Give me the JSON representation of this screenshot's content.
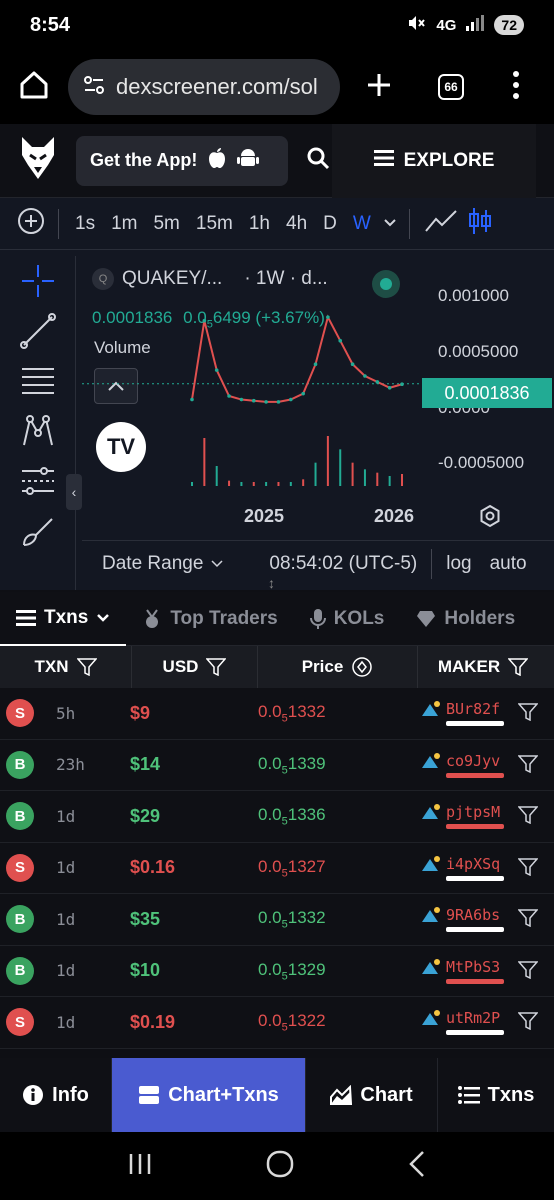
{
  "status": {
    "time": "8:54",
    "network": "4G",
    "battery": "72"
  },
  "browser": {
    "url": "dexscreener.com/sol",
    "tab_count": "66"
  },
  "header": {
    "get_app_label": "Get the App!",
    "explore_label": "EXPLORE"
  },
  "timeframes": {
    "items": [
      "1s",
      "1m",
      "5m",
      "15m",
      "1h",
      "4h",
      "D",
      "W"
    ],
    "active": "W"
  },
  "chart": {
    "title": "QUAKEY/...",
    "interval": "· 1W · d...",
    "legend_price": "0.0001836",
    "legend_change_prefix": "0.0",
    "legend_change_sub": "5",
    "legend_change_rest": "6499 (+3.67%)",
    "volume_label": "Volume",
    "current_price": "0.0001836",
    "y_ticks": [
      "0.001000",
      "0.0005000",
      "0.0000",
      "-0.0005000"
    ],
    "x_ticks": [
      "2025",
      "2026"
    ],
    "date_range_label": "Date Range",
    "clock": "08:54:02 (UTC-5)",
    "log_label": "log",
    "auto_label": "auto"
  },
  "chart_data": {
    "type": "line",
    "title": "QUAKEY/...",
    "x": [
      "2024-07",
      "2024-08",
      "2024-09",
      "2024-10",
      "2024-11",
      "2024-12",
      "2025-01",
      "2025-02",
      "2025-03",
      "2025-04",
      "2025-05",
      "2025-06",
      "2025-07",
      "2025-08",
      "2025-09",
      "2025-10",
      "2025-11",
      "2025-12"
    ],
    "series": [
      {
        "values": [
          5e-05,
          0.00072,
          0.0003,
          8e-05,
          5e-05,
          4e-05,
          3e-05,
          3e-05,
          5e-05,
          0.0001,
          0.00035,
          0.00075,
          0.00055,
          0.00035,
          0.00025,
          0.0002,
          0.00015,
          0.00018
        ]
      }
    ],
    "ylim": [
      -0.0006,
      0.0011
    ]
  },
  "txn_tabs": [
    "Txns",
    "Top Traders",
    "KOLs",
    "Holders"
  ],
  "table": {
    "headers": {
      "txn": "TXN",
      "usd": "USD",
      "price": "Price",
      "maker": "MAKER"
    },
    "rows": [
      {
        "type": "S",
        "age": "5h",
        "usd": "$9",
        "price_prefix": "0.0",
        "price_sub": "5",
        "price_rest": "1332",
        "maker": "BUr82f",
        "maker_color": "#e0504f",
        "bar_color": "#ffffff"
      },
      {
        "type": "B",
        "age": "23h",
        "usd": "$14",
        "price_prefix": "0.0",
        "price_sub": "5",
        "price_rest": "1339",
        "maker": "co9Jyv",
        "maker_color": "#e0504f",
        "bar_color": "#e0504f"
      },
      {
        "type": "B",
        "age": "1d",
        "usd": "$29",
        "price_prefix": "0.0",
        "price_sub": "5",
        "price_rest": "1336",
        "maker": "pjtpsM",
        "maker_color": "#e0504f",
        "bar_color": "#e0504f"
      },
      {
        "type": "S",
        "age": "1d",
        "usd": "$0.16",
        "price_prefix": "0.0",
        "price_sub": "5",
        "price_rest": "1327",
        "maker": "i4pXSq",
        "maker_color": "#e0504f",
        "bar_color": "#ffffff"
      },
      {
        "type": "B",
        "age": "1d",
        "usd": "$35",
        "price_prefix": "0.0",
        "price_sub": "5",
        "price_rest": "1332",
        "maker": "9RA6bs",
        "maker_color": "#e0504f",
        "bar_color": "#ffffff"
      },
      {
        "type": "B",
        "age": "1d",
        "usd": "$10",
        "price_prefix": "0.0",
        "price_sub": "5",
        "price_rest": "1329",
        "maker": "MtPbS3",
        "maker_color": "#e0504f",
        "bar_color": "#e0504f"
      },
      {
        "type": "S",
        "age": "1d",
        "usd": "$0.19",
        "price_prefix": "0.0",
        "price_sub": "5",
        "price_rest": "1322",
        "maker": "utRm2P",
        "maker_color": "#e0504f",
        "bar_color": "#ffffff"
      }
    ]
  },
  "bottom_nav": {
    "info": "Info",
    "chart_txns": "Chart+Txns",
    "chart": "Chart",
    "txns": "Txns"
  },
  "colors": {
    "buy": "#4fc27a",
    "sell": "#e0504f",
    "accent": "#4a5bd0",
    "chart_green": "#22ab94",
    "tf_active": "#2962ff"
  }
}
